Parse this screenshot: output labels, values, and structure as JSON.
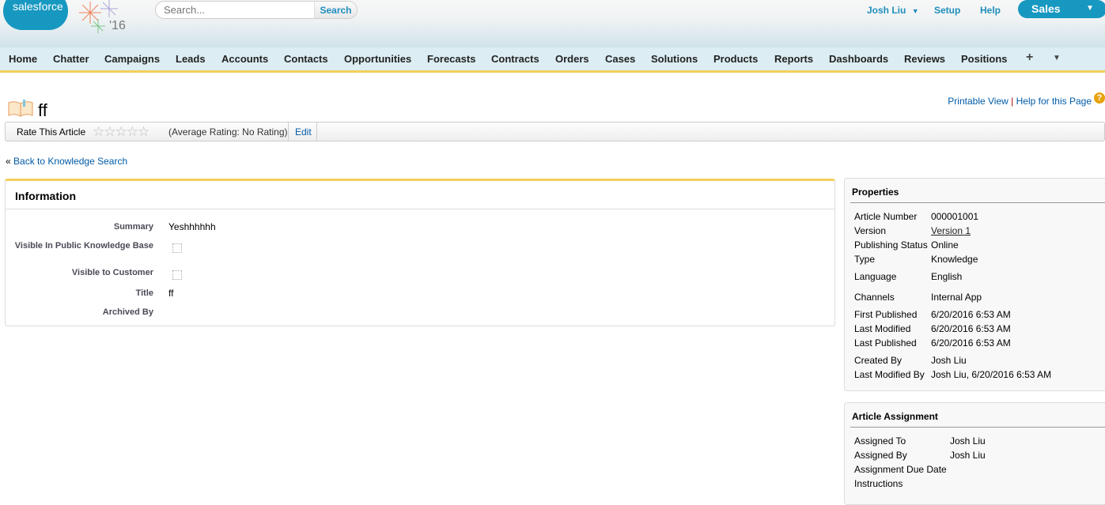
{
  "header": {
    "logo": "salesforce",
    "release": "'16",
    "search_placeholder": "Search...",
    "search_button": "Search",
    "user": "Josh Liu",
    "setup": "Setup",
    "help": "Help",
    "app": "Sales"
  },
  "nav": {
    "tabs": [
      "Home",
      "Chatter",
      "Campaigns",
      "Leads",
      "Accounts",
      "Contacts",
      "Opportunities",
      "Forecasts",
      "Contracts",
      "Orders",
      "Cases",
      "Solutions",
      "Products",
      "Reports",
      "Dashboards",
      "Reviews",
      "Positions"
    ],
    "plus": "+",
    "more": "▼"
  },
  "page": {
    "title": "ff",
    "printable": "Printable View",
    "separator": "|",
    "help_page": "Help for this Page",
    "help_icon": "?"
  },
  "rating": {
    "label": "Rate This Article",
    "stars": "☆☆☆☆☆",
    "average": "(Average Rating: No Rating)",
    "edit": "Edit"
  },
  "back": {
    "prefix": "«",
    "label": "Back to Knowledge Search"
  },
  "information": {
    "title": "Information",
    "fields": [
      {
        "label": "Summary",
        "value": "Yeshhhhhh"
      },
      {
        "label": "Visible In Public Knowledge Base",
        "checked": false
      },
      {
        "label": "Visible to Customer",
        "checked": false
      },
      {
        "label": "Title",
        "value": "ff"
      },
      {
        "label": "Archived By",
        "value": ""
      }
    ]
  },
  "properties": {
    "title": "Properties",
    "rows": [
      {
        "label": "Article Number",
        "value": "000001001"
      },
      {
        "label": "Version",
        "value": "Version 1"
      },
      {
        "label": "Publishing Status",
        "value": "Online"
      },
      {
        "label": "Type",
        "value": "Knowledge"
      },
      {
        "label": "Language",
        "value": "English"
      },
      {
        "label": "Channels",
        "value": "Internal App"
      },
      {
        "label": "First Published",
        "value": "6/20/2016 6:53 AM"
      },
      {
        "label": "Last Modified",
        "value": "6/20/2016 6:53 AM"
      },
      {
        "label": "Last Published",
        "value": "6/20/2016 6:53 AM"
      },
      {
        "label": "Created By",
        "value": "Josh Liu"
      },
      {
        "label": "Last Modified By",
        "value": "Josh Liu, 6/20/2016 6:53 AM"
      }
    ]
  },
  "assignment": {
    "title": "Article Assignment",
    "rows": [
      {
        "label": "Assigned To",
        "value": "Josh Liu"
      },
      {
        "label": "Assigned By",
        "value": "Josh Liu"
      },
      {
        "label": "Assignment Due Date",
        "value": ""
      },
      {
        "label": "Instructions",
        "value": ""
      }
    ]
  },
  "colors": {
    "brand": "#1798c1",
    "accent": "#f3cf5b",
    "link": "#015ba7"
  }
}
